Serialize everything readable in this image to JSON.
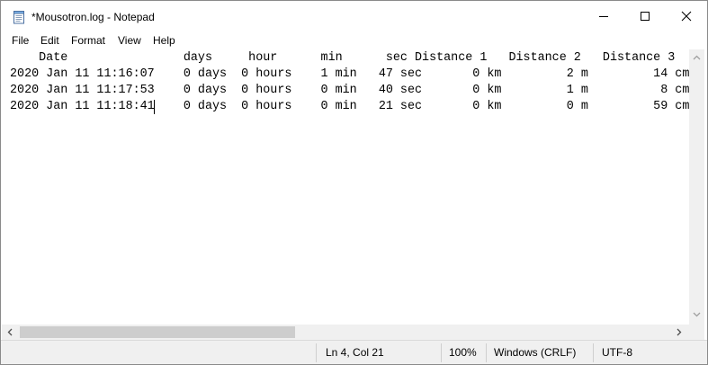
{
  "window": {
    "title": "*Mousotron.log - Notepad",
    "app_icon": "notepad-icon",
    "buttons": {
      "minimize_icon": "minimize-icon",
      "maximize_icon": "maximize-icon",
      "close_icon": "close-icon"
    }
  },
  "menu": {
    "items": [
      "File",
      "Edit",
      "Format",
      "View",
      "Help"
    ]
  },
  "editor": {
    "lines": [
      "    Date                days     hour      min      sec Distance 1   Distance 2   Distance 3",
      "2020 Jan 11 11:16:07    0 days  0 hours    1 min   47 sec       0 km         2 m         14 cm",
      "2020 Jan 11 11:17:53    0 days  0 hours    0 min   40 sec       0 km         1 m          8 cm",
      "2020 Jan 11 11:18:41    0 days  0 hours    0 min   21 sec       0 km         0 m         59 cm"
    ]
  },
  "scrollbars": {
    "vertical": {
      "up_icon": "scroll-up-arrow-icon",
      "down_icon": "scroll-down-arrow-icon"
    },
    "horizontal": {
      "left_icon": "scroll-left-arrow-icon",
      "right_icon": "scroll-right-arrow-icon"
    }
  },
  "statusbar": {
    "position": "Ln 4, Col 21",
    "zoom": "100%",
    "line_ending": "Windows (CRLF)",
    "encoding": "UTF-8"
  }
}
